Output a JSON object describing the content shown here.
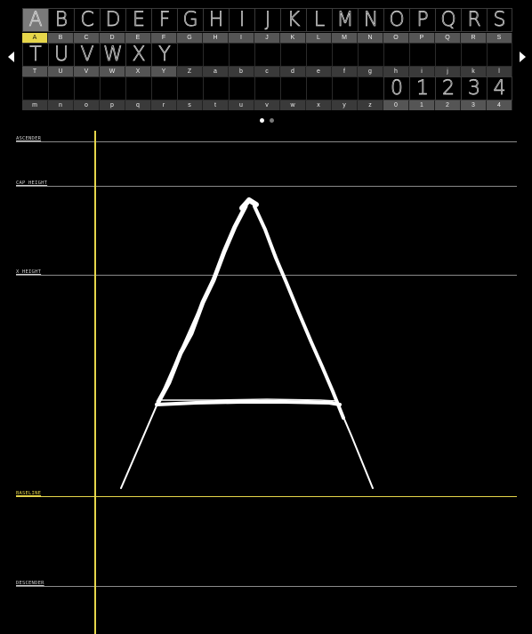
{
  "glyph_grid": {
    "row1": [
      "A",
      "B",
      "C",
      "D",
      "E",
      "F",
      "G",
      "H",
      "I",
      "J",
      "K",
      "L",
      "M",
      "N",
      "O",
      "P",
      "Q",
      "R",
      "S"
    ],
    "row2": [
      "T",
      "U",
      "V",
      "W",
      "X",
      "Y",
      "Z",
      "a",
      "b",
      "c",
      "d",
      "e",
      "f",
      "g",
      "h",
      "i",
      "j",
      "k",
      "l"
    ],
    "row3": [
      "m",
      "n",
      "o",
      "p",
      "q",
      "r",
      "s",
      "t",
      "u",
      "v",
      "w",
      "x",
      "y",
      "z",
      "0",
      "1",
      "2",
      "3",
      "4"
    ],
    "row1_labels": [
      "A",
      "B",
      "C",
      "D",
      "E",
      "F",
      "G",
      "H",
      "I",
      "J",
      "K",
      "L",
      "M",
      "N",
      "O",
      "P",
      "Q",
      "R",
      "S"
    ],
    "row2_labels": [
      "T",
      "U",
      "V",
      "W",
      "X",
      "Y",
      "Z",
      "a",
      "b",
      "c",
      "d",
      "e",
      "f",
      "g",
      "h",
      "i",
      "j",
      "k",
      "l"
    ],
    "row3_labels": [
      "m",
      "n",
      "o",
      "p",
      "q",
      "r",
      "s",
      "t",
      "u",
      "v",
      "w",
      "x",
      "y",
      "z",
      "0",
      "1",
      "2",
      "3",
      "4"
    ],
    "selected": "A",
    "row1_drawn": 19,
    "row2_drawn": 6,
    "row3_drawn": 5
  },
  "pager": {
    "pages": 2,
    "current": 1
  },
  "guides": {
    "ascender": "ASCENDER",
    "cap_height": "CAP_HEIGHT",
    "x_height": "X_HEIGHT",
    "baseline": "BASELINE",
    "descender": "DESCENDER"
  },
  "colors": {
    "accent": "#e6d64a",
    "background": "#000000",
    "guide": "#8a8a8a"
  },
  "icons": {
    "prev": "chevron-left-icon",
    "next": "chevron-right-icon"
  }
}
